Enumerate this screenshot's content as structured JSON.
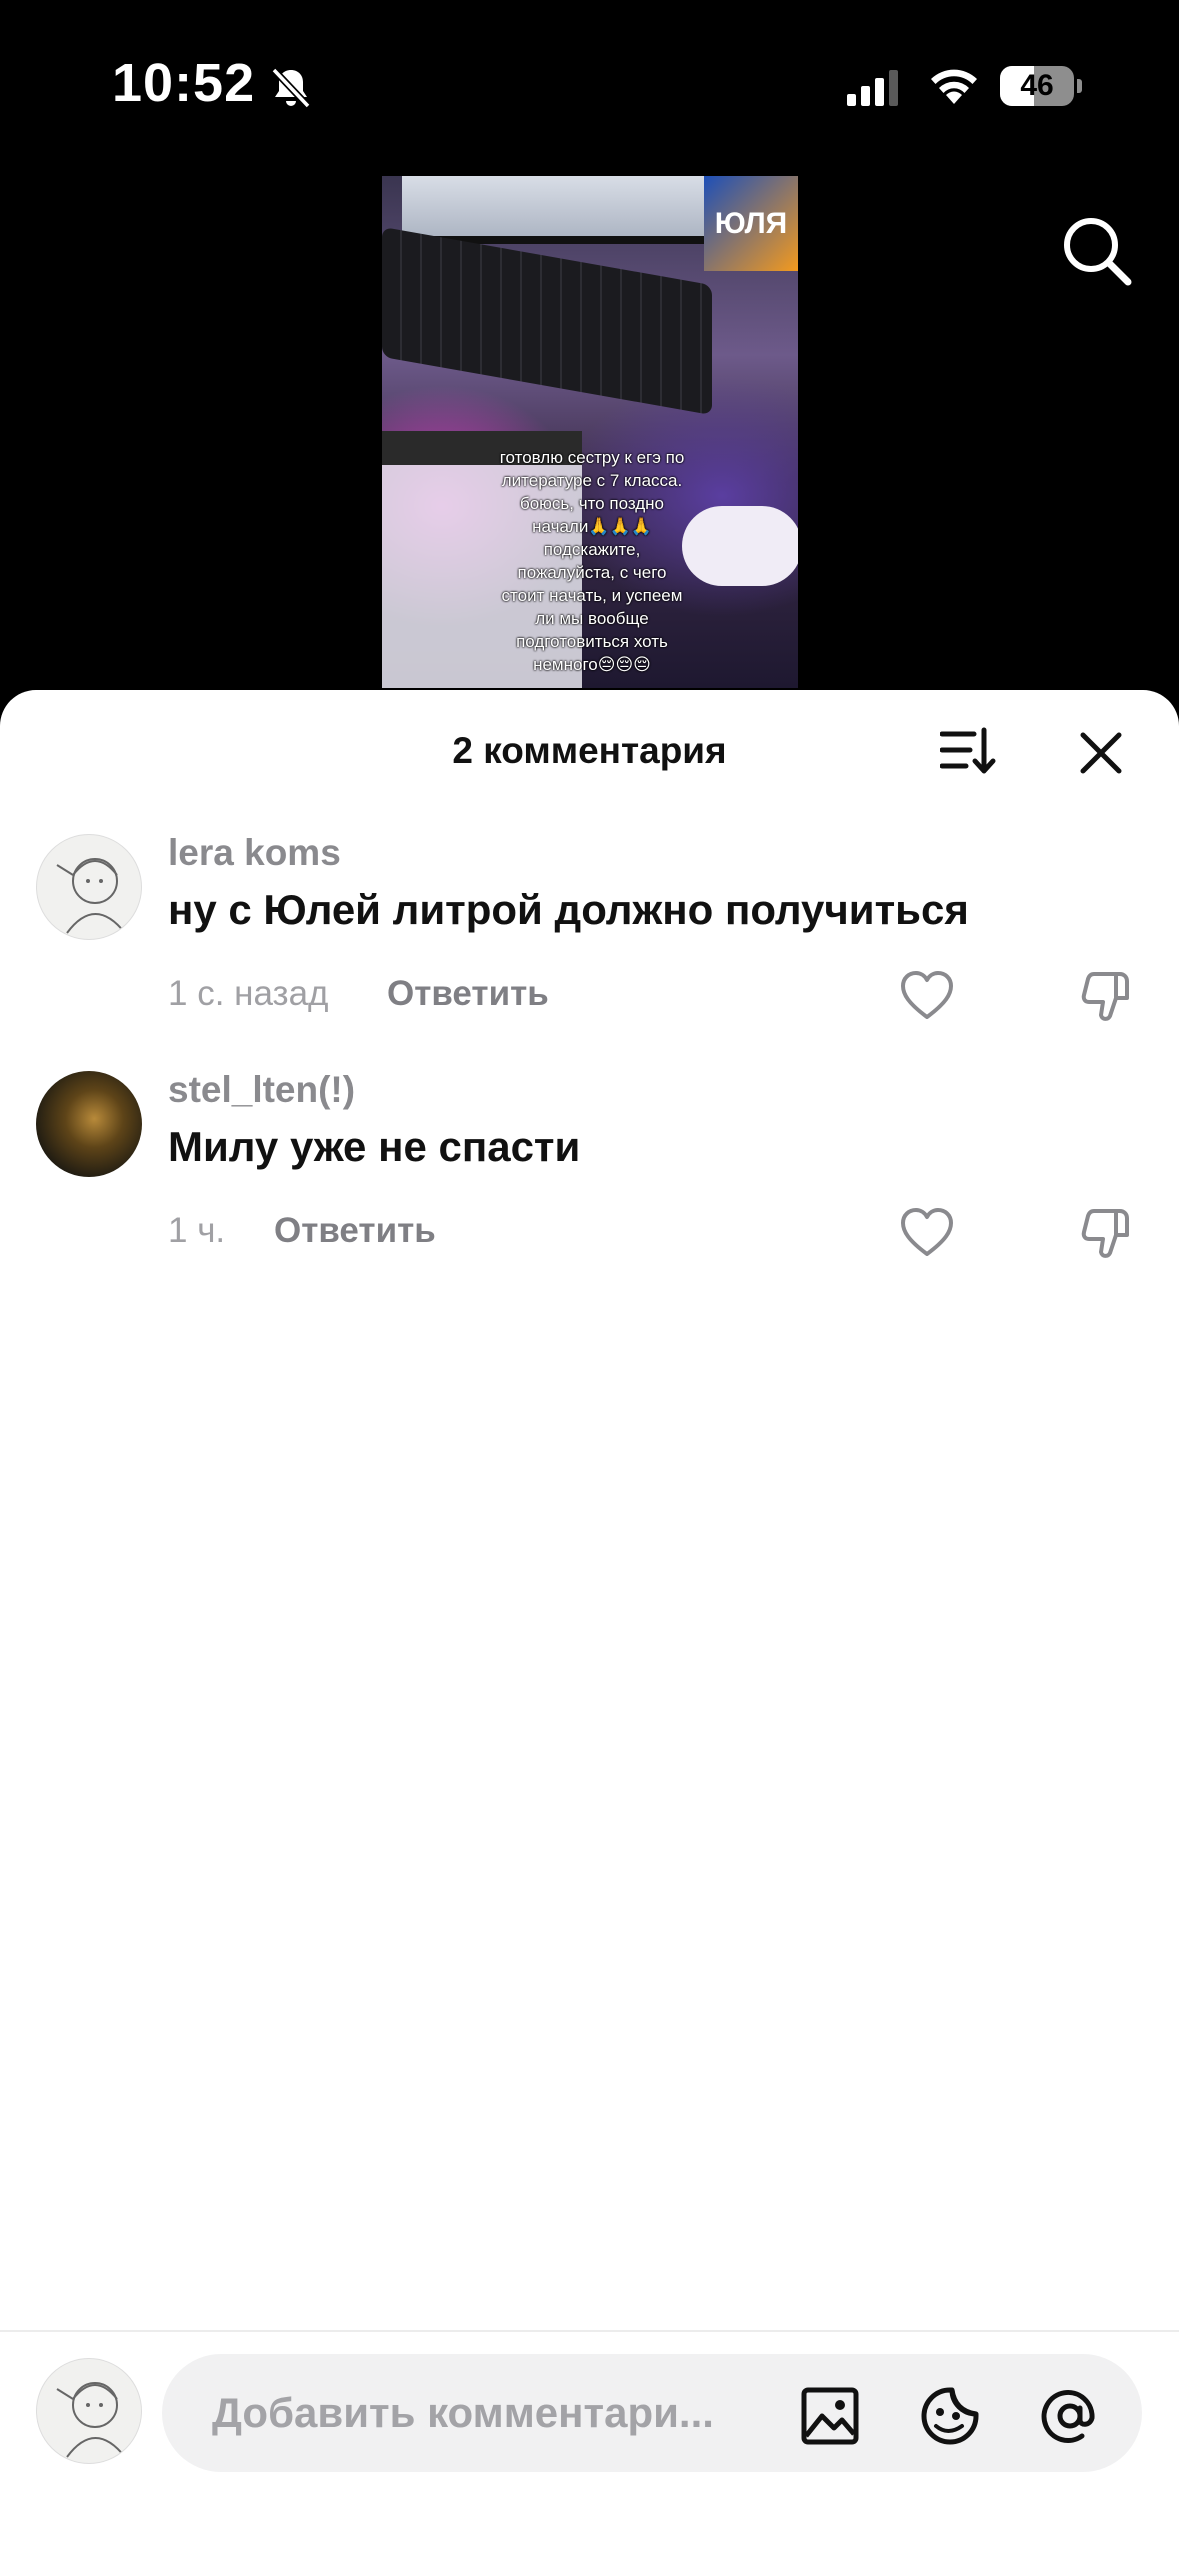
{
  "status_bar": {
    "time": "10:52",
    "battery_percent": "46",
    "battery_level": 0.46,
    "silent_mode": true
  },
  "video": {
    "poster_text": "ЮЛЯ",
    "caption_lines": [
      "готовлю сестру к егэ по",
      "литературе с 7 класса.",
      "боюсь, что поздно",
      "начали🙏🙏🙏",
      "подскажите,",
      "пожалуйста, с чего",
      "стоит начать, и успеем",
      "ли мы вообще",
      "подготовиться хоть",
      "немного😔😔😔"
    ]
  },
  "comments_sheet": {
    "title": "2 комментария",
    "comments": [
      {
        "username": "lera koms",
        "text": "ну с Юлей литрой должно получиться",
        "time": "1 с. назад",
        "reply_label": "Ответить"
      },
      {
        "username": "stel_lten(!)",
        "text": "Милу уже не спасти",
        "time": "1 ч.",
        "reply_label": "Ответить"
      }
    ]
  },
  "composer": {
    "placeholder": "Добавить комментари..."
  },
  "colors": {
    "sheet_bg": "#ffffff",
    "username": "#8a8a8e",
    "text": "#111111",
    "meta": "#a0a0a4"
  }
}
